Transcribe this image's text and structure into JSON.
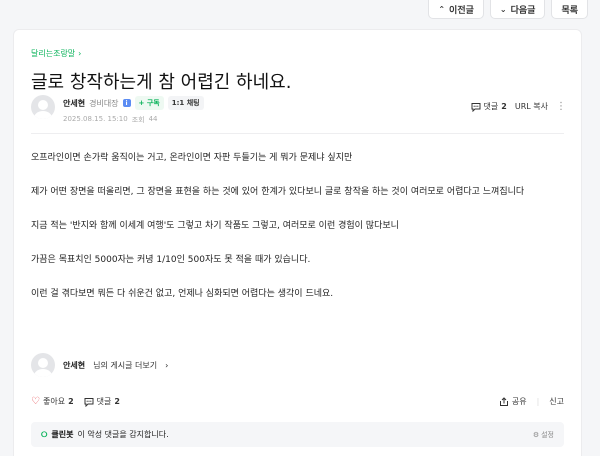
{
  "nav": {
    "prev": "이전글",
    "next": "다음글",
    "list": "목록"
  },
  "post": {
    "cafe": "달리는조랑말",
    "title": "글로 창작하는게 참 어렵긴 하네요.",
    "author": "안세현",
    "rank": "경비대장",
    "subscribe": "+ 구독",
    "chat": "1:1 채팅",
    "date": "2025.08.15. 15:10",
    "views_label": "조회",
    "views": "44",
    "comments_label": "댓글",
    "comments": "2",
    "url_copy": "URL 복사",
    "paragraphs": [
      "오프라인이면 손가락 움직이는 거고, 온라인이면 자판 두들기는 게 뭐가 문제냐 싶지만",
      "제가 어떤 장면을 떠올리면, 그 장면을 표현을 하는 것에 있어 한계가 있다보니 글로 창작을 하는 것이 여러모로 어렵다고 느껴집니다",
      "지금 적는 '반지와 함께 이세계 여행'도 그렇고 차기 작품도 그렇고, 여러모로 이런 경험이 많다보니",
      "가끔은 목표치인 5000자는 커녕 1/10인 500자도 못 적을 때가 있습니다.",
      "이런 걸 겪다보면 뭐든 다 쉬운건 없고, 언제나 심화되면 어렵다는 생각이 드네요."
    ],
    "author_more_suffix": "님의 게시글 더보기"
  },
  "interactions": {
    "like_label": "좋아요",
    "likes": "2",
    "comment_label": "댓글",
    "comments": "2",
    "share": "공유",
    "report": "신고"
  },
  "cleanbot": {
    "name": "클린봇",
    "message": "이 악성 댓글을 감지합니다.",
    "setting": "설정"
  },
  "colors": {
    "brand_green": "#0bb35b",
    "like_red": "#e5484d"
  }
}
